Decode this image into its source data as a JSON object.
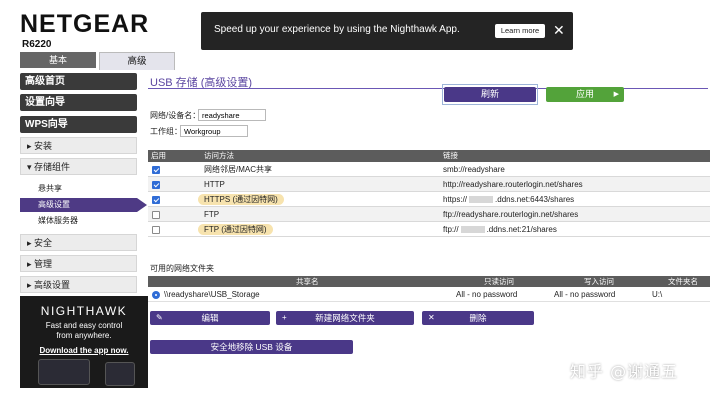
{
  "header": {
    "brand": "NETGEAR",
    "model": "R6220",
    "tabs": [
      {
        "label": "基本",
        "active": false
      },
      {
        "label": "高级",
        "active": true
      }
    ]
  },
  "banner": {
    "text": "Speed up your experience by using the Nighthawk App.",
    "button_label": "Learn more",
    "close_icon": "✕"
  },
  "sidebar": {
    "dark_items": [
      "高级首页",
      "设置向导",
      "WPS向导"
    ],
    "sections": [
      {
        "label": "▸ 安装"
      },
      {
        "label": "▾ 存储组件"
      },
      {
        "label": "▸ 安全"
      },
      {
        "label": "▸ 管理"
      },
      {
        "label": "▸ 高级设置"
      }
    ],
    "storage_sub": [
      {
        "label": "悬共享",
        "active": false
      },
      {
        "label": "高级设置",
        "active": true
      },
      {
        "label": "媒体服务器",
        "active": false
      }
    ],
    "promo": {
      "title": "NIGHTHAWK",
      "line1": "Fast and easy control",
      "line2": "from anywhere.",
      "link": "Download the app now."
    }
  },
  "main": {
    "title": "USB 存储 (高级设置)",
    "refresh_label": "刷新",
    "apply_label": "应用",
    "apply_arrow": "▶",
    "device_name_label": "网络/设备名：",
    "device_name_value": "readyshare",
    "workgroup_label": "工作组：",
    "workgroup_value": "Workgroup",
    "access_table": {
      "headers": [
        "启用",
        "访问方法",
        "链接"
      ],
      "rows": [
        {
          "enabled": true,
          "method": "网络邻居/MAC共享",
          "link": "smb://readyshare",
          "highlight": false
        },
        {
          "enabled": true,
          "method": "HTTP",
          "link": "http://readyshare.routerlogin.net/shares",
          "highlight": false
        },
        {
          "enabled": true,
          "method": "HTTPS (通过因特网)",
          "link_prefix": "https://",
          "link_suffix": ".ddns.net:6443/shares",
          "highlight": true
        },
        {
          "enabled": false,
          "method": "FTP",
          "link": "ftp://readyshare.routerlogin.net/shares",
          "highlight": false
        },
        {
          "enabled": false,
          "method": "FTP (通过因特网)",
          "link_prefix": "ftp://",
          "link_suffix": ".ddns.net:21/shares",
          "highlight": true
        }
      ]
    },
    "shares": {
      "title": "可用的网络文件夹",
      "headers": [
        "共享名",
        "只读访问",
        "写入访问",
        "文件夹名"
      ],
      "rows": [
        {
          "name": "\\\\readyshare\\USB_Storage",
          "read": "All - no password",
          "write": "All - no password",
          "folder": "U:\\"
        }
      ]
    },
    "buttons": {
      "edit": "编辑",
      "new_folder": "新建网络文件夹",
      "delete": "删除",
      "safe_remove": "安全地移除 USB 设备",
      "edit_icon": "✎",
      "new_icon": "+",
      "delete_icon": "✕"
    }
  },
  "watermark": "知乎 @谢通五",
  "colors": {
    "accent_purple": "#4a3888",
    "title_purple": "#5a45a0",
    "apply_green": "#53a33a",
    "table_header": "#5c5c5c",
    "checkbox_blue": "#2f6cd6",
    "highlight_pill": "#f7e3ae"
  }
}
